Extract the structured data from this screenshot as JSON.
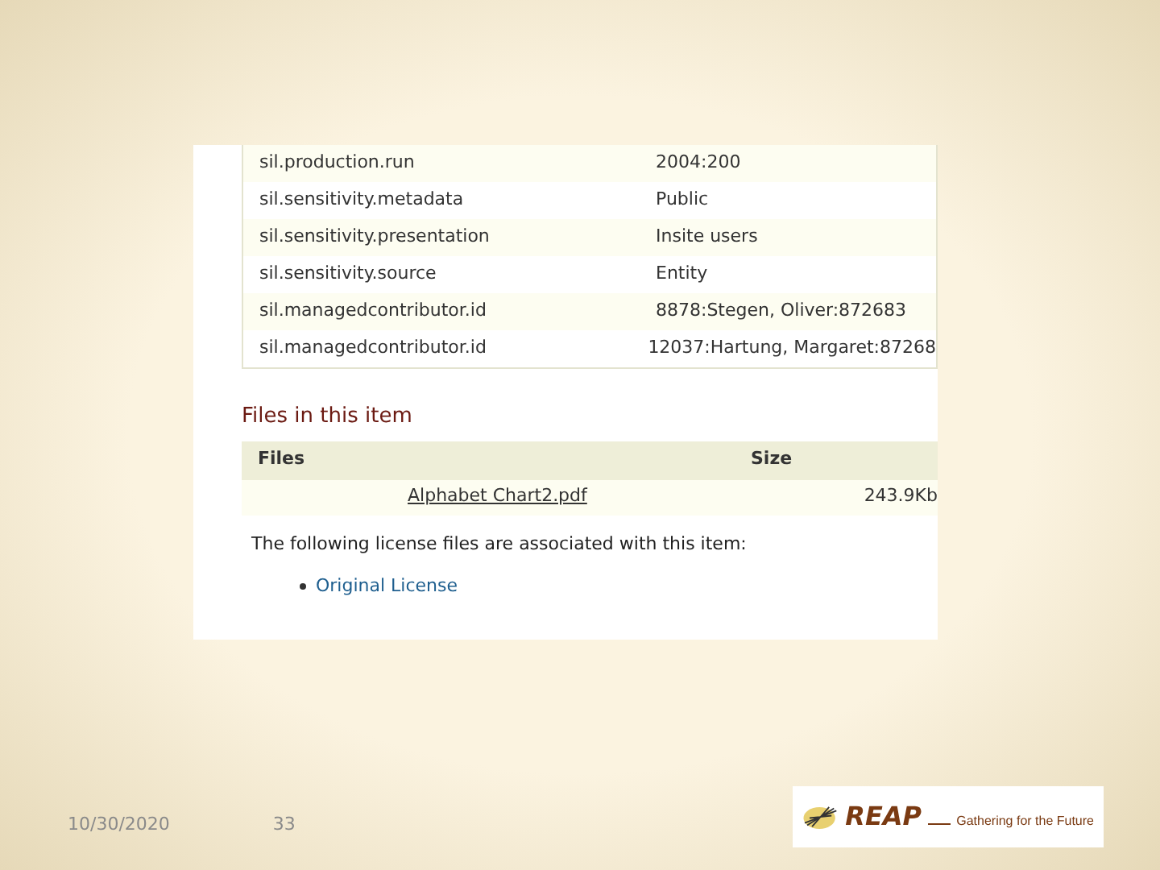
{
  "metadata_rows": [
    {
      "field": "sil.production.run",
      "value": "2004:200"
    },
    {
      "field": "sil.sensitivity.metadata",
      "value": "Public"
    },
    {
      "field": "sil.sensitivity.presentation",
      "value": "Insite users"
    },
    {
      "field": "sil.sensitivity.source",
      "value": "Entity"
    },
    {
      "field": "sil.managedcontributor.id",
      "value": "8878:Stegen, Oliver:872683"
    },
    {
      "field": "sil.managedcontributor.id",
      "value": "12037:Hartung, Margaret:87268"
    }
  ],
  "files_section": {
    "heading": "Files in this item",
    "columns": [
      "Files",
      "Size"
    ],
    "rows": [
      {
        "name": "Alphabet Chart2.pdf",
        "size": "243.9Kb"
      }
    ],
    "license_note": "The following license files are associated with this item:",
    "license_links": [
      "Original License"
    ]
  },
  "footer": {
    "date": "10/30/2020",
    "page": "33",
    "logo": {
      "name": "REAP",
      "tagline": "Gathering for the Future"
    }
  }
}
